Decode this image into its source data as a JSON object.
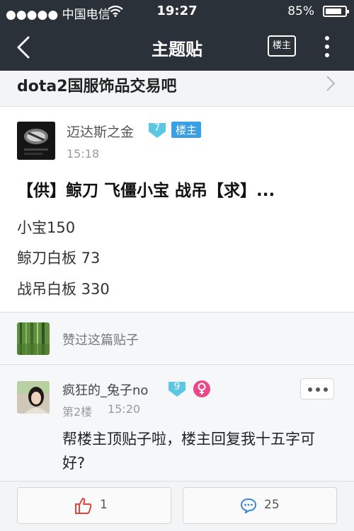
{
  "status_bar": {
    "carrier": "●●●●● 中国电信",
    "time": "19:27",
    "battery_percent_text": "85%",
    "battery_level": 0.85
  },
  "nav": {
    "title": "主题贴",
    "owner_only_label": "楼主",
    "back_icon": "chevron-left-icon",
    "more_icon": "vertical-dots-icon"
  },
  "forum": {
    "name": "dota2国服饰品交易吧",
    "chevron_icon": "chevron-right-icon"
  },
  "post": {
    "author": "迈达斯之金",
    "level": "7",
    "owner_tag": "楼主",
    "time": "15:18",
    "title": "【供】鲸刀 飞僵小宝 战吊【求】...",
    "lines": [
      "小宝150",
      "鲸刀白板 73",
      "战吊白板 330"
    ]
  },
  "likes": {
    "text": "赞过这篇贴子"
  },
  "reply": {
    "author": "疯狂的_兔子no",
    "level": "9",
    "gender_icon": "female-symbol-icon",
    "floor": "第2楼",
    "time": "15:20",
    "content": "帮楼主顶贴子啦，楼主回复我十五字可好?"
  },
  "bottom": {
    "like_count": "1",
    "comment_count": "25"
  },
  "colors": {
    "bar_dark": "#2b3138",
    "level_badge": "#5cc6e3",
    "owner_tag": "#3aa0e3",
    "female_badge": "#e9488a",
    "like_red": "#e0443c",
    "comment_blue": "#3d86d8"
  }
}
